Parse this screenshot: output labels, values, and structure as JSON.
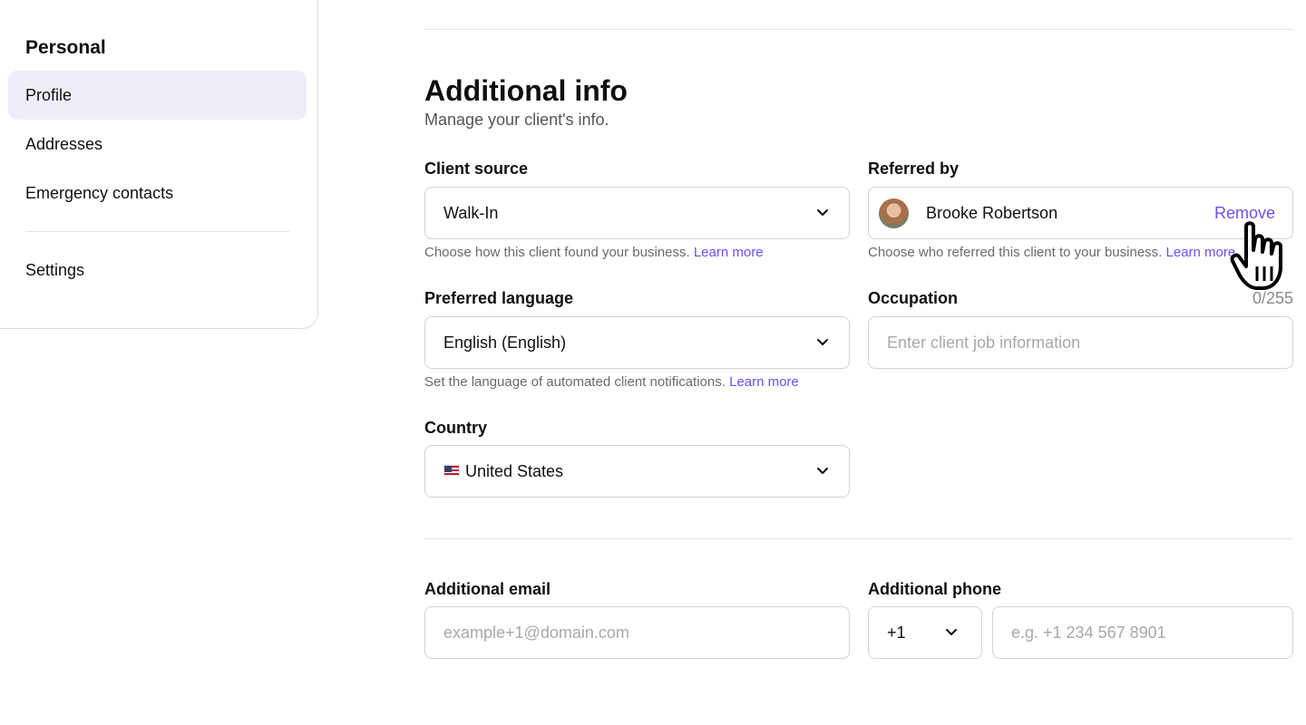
{
  "sidebar": {
    "heading": "Personal",
    "items": [
      {
        "label": "Profile",
        "active": true
      },
      {
        "label": "Addresses",
        "active": false
      },
      {
        "label": "Emergency contacts",
        "active": false
      },
      {
        "label": "Settings",
        "active": false
      }
    ]
  },
  "section": {
    "title": "Additional info",
    "subtitle": "Manage your client's info."
  },
  "client_source": {
    "label": "Client source",
    "value": "Walk-In",
    "help": "Choose how this client found your business.",
    "link": "Learn more"
  },
  "referred_by": {
    "label": "Referred by",
    "name": "Brooke Robertson",
    "remove": "Remove",
    "help": "Choose who referred this client to your business.",
    "link": "Learn more"
  },
  "preferred_language": {
    "label": "Preferred language",
    "value": "English (English)",
    "help": "Set the language of automated client notifications.",
    "link": "Learn more"
  },
  "occupation": {
    "label": "Occupation",
    "counter": "0/255",
    "placeholder": "Enter client job information"
  },
  "country": {
    "label": "Country",
    "value": "United States",
    "flag_icon": "us-flag-icon"
  },
  "additional_email": {
    "label": "Additional email",
    "placeholder": "example+1@domain.com"
  },
  "additional_phone": {
    "label": "Additional phone",
    "country_code": "+1",
    "placeholder": "e.g. +1 234 567 8901"
  },
  "colors": {
    "accent": "#6950f3",
    "active_bg": "#eeeef9",
    "border": "#d3d3d3"
  }
}
